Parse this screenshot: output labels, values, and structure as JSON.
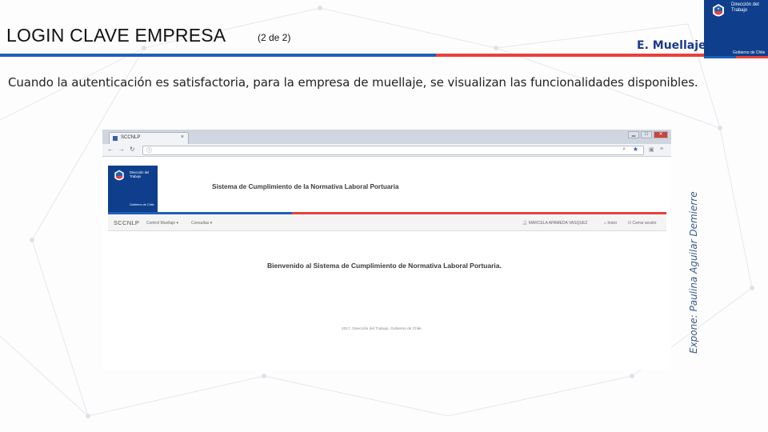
{
  "slide": {
    "title": "LOGIN CLAVE EMPRESA",
    "page_indicator": "(2 de 2)",
    "section": "E. Muellaje",
    "intro": "Cuando la autenticación es satisfactoria, para la empresa de muellaje, se visualizan las funcionalidades disponibles.",
    "presenter": "Expone: Paulina Aguilar Demierre",
    "logo": {
      "org": "Dirección del Trabajo",
      "gov": "Gobierno de Chile"
    },
    "colors": {
      "title_bar_blue": "#1f5fb8",
      "title_bar_red": "#e8413d",
      "logo_blue": "#0f3f8c",
      "section_text": "#1a3a8a"
    }
  },
  "browser": {
    "tab_title": "SCCNLP",
    "tab_close": "×",
    "window_buttons": [
      "▁",
      "□",
      "✕"
    ],
    "nav_icons": [
      "back-icon",
      "forward-icon",
      "reload-icon"
    ],
    "address_info_icon": "info-icon",
    "toolbar_icons": [
      "zoom-icon",
      "star-icon"
    ],
    "extension_icons": [
      "extension-icon",
      "menu-icon"
    ]
  },
  "site": {
    "logo_org": "Dirección del Trabajo",
    "logo_gov": "Gobierno de Chile",
    "title": "Sistema de Cumplimiento de la Normativa Laboral Portuaria",
    "brand": "SCCNLP",
    "menu": [
      "Control Muellaje ▾",
      "Consultas ▾"
    ],
    "user_name": "MARCELA APAMEDA VASQUEZ",
    "home_label": "Inicio",
    "logout_label": "Cerrar sesión",
    "welcome": "Bienvenido al Sistema de Cumplimiento de Normativa Laboral Portuaria.",
    "footer": "2017, Dirección del Trabajo, Gobierno de Chile."
  }
}
